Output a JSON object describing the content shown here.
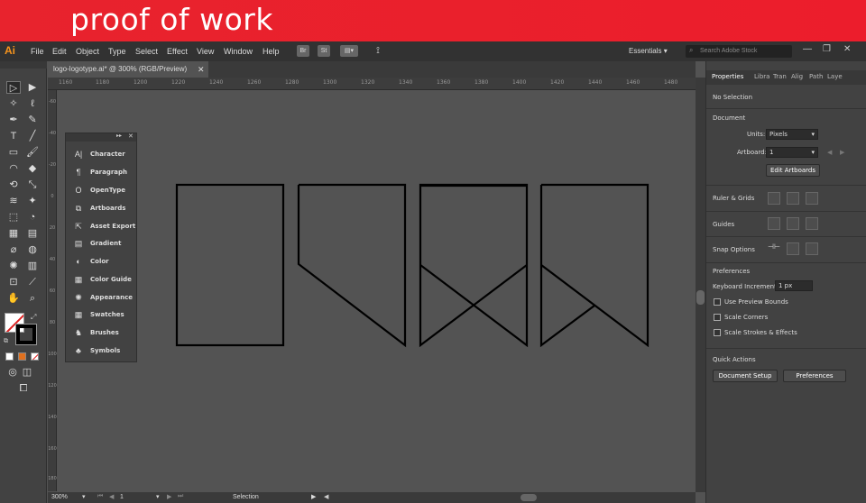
{
  "banner": {
    "title": "proof of work"
  },
  "menubar": {
    "logo": "Ai",
    "menus": [
      "File",
      "Edit",
      "Object",
      "Type",
      "Select",
      "Effect",
      "View",
      "Window",
      "Help"
    ],
    "bridge_br": "Br",
    "bridge_st": "St",
    "workspace": "Essentials",
    "search_placeholder": "Search Adobe Stock"
  },
  "document": {
    "tab_title": "logo-logotype.ai* @ 300% (RGB/Preview)"
  },
  "rulers": {
    "top": [
      "1160",
      "1180",
      "1200",
      "1220",
      "1240",
      "1260",
      "1280",
      "1300",
      "1320",
      "1340",
      "1360",
      "1380",
      "1400",
      "1420",
      "1440",
      "1460",
      "1480"
    ],
    "left": [
      "-60",
      "-40",
      "-20",
      "0",
      "20",
      "40",
      "60",
      "80",
      "100",
      "120",
      "140",
      "160",
      "180"
    ]
  },
  "panels_float": {
    "items": [
      {
        "label": "Character",
        "icon": "character-icon",
        "glyph": "A|"
      },
      {
        "label": "Paragraph",
        "icon": "paragraph-icon",
        "glyph": "¶"
      },
      {
        "label": "OpenType",
        "icon": "opentype-icon",
        "glyph": "O"
      },
      {
        "label": "Artboards",
        "icon": "artboards-icon",
        "glyph": "⧉"
      },
      {
        "label": "Asset Export",
        "icon": "asset-export-icon",
        "glyph": "⇱"
      },
      {
        "label": "Gradient",
        "icon": "gradient-icon",
        "glyph": "▤"
      },
      {
        "label": "Color",
        "icon": "color-icon",
        "glyph": "◐"
      },
      {
        "label": "Color Guide",
        "icon": "color-guide-icon",
        "glyph": "▦"
      },
      {
        "label": "Appearance",
        "icon": "appearance-icon",
        "glyph": "✺"
      },
      {
        "label": "Swatches",
        "icon": "swatches-icon",
        "glyph": "▦"
      },
      {
        "label": "Brushes",
        "icon": "brushes-icon",
        "glyph": "♞"
      },
      {
        "label": "Symbols",
        "icon": "symbols-icon",
        "glyph": "♣"
      }
    ]
  },
  "properties": {
    "tabs": [
      "Properties",
      "Libra",
      "Tran",
      "Alig",
      "Path",
      "Laye"
    ],
    "no_selection": "No Selection",
    "document_label": "Document",
    "units_label": "Units:",
    "units_value": "Pixels",
    "artboard_label": "Artboard:",
    "artboard_value": "1",
    "edit_artboards": "Edit Artboards",
    "ruler_grids": "Ruler & Grids",
    "guides": "Guides",
    "snap_options": "Snap Options",
    "preferences_label": "Preferences",
    "keyboard_increment_label": "Keyboard Increment:",
    "keyboard_increment_value": "1 px",
    "use_preview_bounds": "Use Preview Bounds",
    "scale_corners": "Scale Corners",
    "scale_strokes": "Scale Strokes & Effects",
    "quick_actions": "Quick Actions",
    "document_setup": "Document Setup",
    "preferences_button": "Preferences"
  },
  "status": {
    "zoom": "300%",
    "artboard_num": "1",
    "tool": "Selection"
  }
}
